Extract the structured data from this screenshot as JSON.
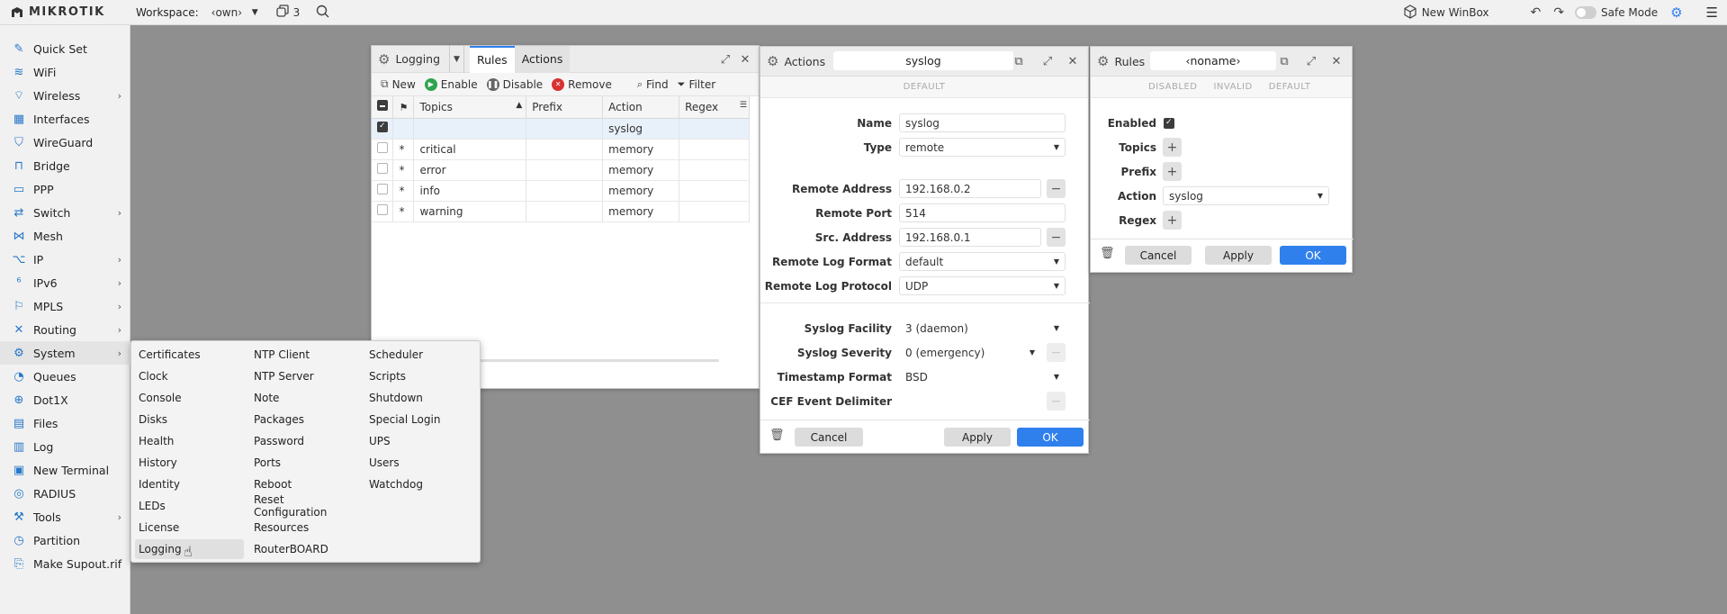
{
  "topbar": {
    "brand": "MikroTik",
    "workspace_label": "Workspace:",
    "workspace_value": "‹own›",
    "windows_count": "3",
    "new_winbox": "New WinBox",
    "safe_mode": "Safe Mode"
  },
  "sidebar": {
    "items": [
      {
        "label": "Quick Set",
        "icon": "quickset-icon"
      },
      {
        "label": "WiFi",
        "icon": "wifi-icon"
      },
      {
        "label": "Wireless",
        "icon": "wireless-icon"
      },
      {
        "label": "Interfaces",
        "icon": "interfaces-icon"
      },
      {
        "label": "WireGuard",
        "icon": "wireguard-icon"
      },
      {
        "label": "Bridge",
        "icon": "bridge-icon"
      },
      {
        "label": "PPP",
        "icon": "ppp-icon"
      },
      {
        "label": "Switch",
        "icon": "switch-icon"
      },
      {
        "label": "Mesh",
        "icon": "mesh-icon"
      },
      {
        "label": "IP",
        "icon": "ip-icon"
      },
      {
        "label": "IPv6",
        "icon": "ipv6-icon"
      },
      {
        "label": "MPLS",
        "icon": "mpls-icon"
      },
      {
        "label": "Routing",
        "icon": "routing-icon"
      },
      {
        "label": "System",
        "icon": "system-icon"
      },
      {
        "label": "Queues",
        "icon": "queues-icon"
      },
      {
        "label": "Dot1X",
        "icon": "dot1x-icon"
      },
      {
        "label": "Files",
        "icon": "files-icon"
      },
      {
        "label": "Log",
        "icon": "log-icon"
      },
      {
        "label": "New Terminal",
        "icon": "terminal-icon"
      },
      {
        "label": "RADIUS",
        "icon": "radius-icon"
      },
      {
        "label": "Tools",
        "icon": "tools-icon"
      },
      {
        "label": "Partition",
        "icon": "partition-icon"
      },
      {
        "label": "Make Supout.rif",
        "icon": "supout-icon"
      }
    ]
  },
  "logging_window": {
    "title": "Logging",
    "tabs": [
      "Rules",
      "Actions"
    ],
    "toolbar": {
      "new": "New",
      "enable": "Enable",
      "disable": "Disable",
      "remove": "Remove",
      "find": "Find",
      "filter": "Filter"
    },
    "columns": [
      "Topics",
      "Prefix",
      "Action",
      "Regex"
    ],
    "rows": [
      {
        "flag": "",
        "topics": "",
        "prefix": "",
        "action": "syslog",
        "regex": ""
      },
      {
        "flag": "*",
        "topics": "critical",
        "prefix": "",
        "action": "memory",
        "regex": ""
      },
      {
        "flag": "*",
        "topics": "error",
        "prefix": "",
        "action": "memory",
        "regex": ""
      },
      {
        "flag": "*",
        "topics": "info",
        "prefix": "",
        "action": "memory",
        "regex": ""
      },
      {
        "flag": "*",
        "topics": "warning",
        "prefix": "",
        "action": "memory",
        "regex": ""
      }
    ]
  },
  "actions_window": {
    "title": "Actions",
    "header_value": "syslog",
    "status": "DEFAULT",
    "fields": {
      "name_label": "Name",
      "name": "syslog",
      "type_label": "Type",
      "type": "remote",
      "remote_address_label": "Remote Address",
      "remote_address": "192.168.0.2",
      "remote_port_label": "Remote Port",
      "remote_port": "514",
      "src_address_label": "Src. Address",
      "src_address": "192.168.0.1",
      "remote_log_format_label": "Remote Log Format",
      "remote_log_format": "default",
      "remote_log_protocol_label": "Remote Log Protocol",
      "remote_log_protocol": "UDP",
      "syslog_facility_label": "Syslog Facility",
      "syslog_facility": "3 (daemon)",
      "syslog_severity_label": "Syslog Severity",
      "syslog_severity": "0 (emergency)",
      "timestamp_format_label": "Timestamp Format",
      "timestamp_format": "BSD",
      "cef_label": "CEF Event Delimiter"
    },
    "buttons": {
      "cancel": "Cancel",
      "apply": "Apply",
      "ok": "OK"
    }
  },
  "rules_window": {
    "title": "Rules",
    "header_value": "‹noname›",
    "status": [
      "DISABLED",
      "INVALID",
      "DEFAULT"
    ],
    "fields": {
      "enabled_label": "Enabled",
      "topics_label": "Topics",
      "prefix_label": "Prefix",
      "action_label": "Action",
      "action": "syslog",
      "regex_label": "Regex"
    },
    "buttons": {
      "cancel": "Cancel",
      "apply": "Apply",
      "ok": "OK"
    }
  },
  "system_menu": {
    "col1": [
      "Certificates",
      "Clock",
      "Console",
      "Disks",
      "Health",
      "History",
      "Identity",
      "LEDs",
      "License",
      "Logging"
    ],
    "col2": [
      "NTP Client",
      "NTP Server",
      "Note",
      "Packages",
      "Password",
      "Ports",
      "Reboot",
      "Reset Configuration",
      "Resources",
      "RouterBOARD"
    ],
    "col3": [
      "Scheduler",
      "Scripts",
      "Shutdown",
      "Special Login",
      "UPS",
      "Users",
      "Watchdog"
    ]
  },
  "colors": {
    "accent": "#2f80ed",
    "sidebar_icon": "#2877c8",
    "desktop": "#8f8f8f"
  }
}
